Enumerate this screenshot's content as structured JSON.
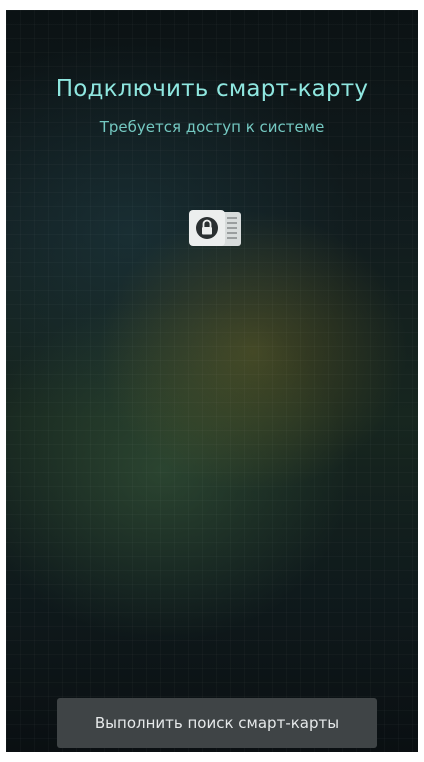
{
  "screen": {
    "title": "Подключить смарт-карту",
    "subtitle": "Требуется доступ к системе",
    "icon": "smart-card-lock-icon",
    "search_button_label": "Выполнить поиск смарт-карты"
  },
  "colors": {
    "title": "#8fe7e0",
    "subtitle": "#74c8c1",
    "button_bg": "#3f4446",
    "button_text": "#e6e9ea"
  }
}
